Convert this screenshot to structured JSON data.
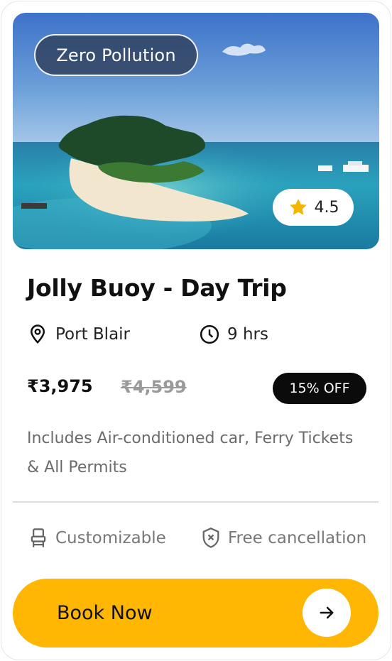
{
  "card": {
    "badge": "Zero Pollution",
    "rating": "4.5",
    "title": "Jolly Buoy - Day Trip",
    "location": "Port Blair",
    "duration": "9 hrs",
    "price": "₹3,975",
    "original_price": "₹4,599",
    "discount": "15% OFF",
    "description": "Includes Air-conditioned car, Ferry Tickets & All Permits",
    "features": {
      "customizable": "Customizable",
      "cancellation": "Free cancellation"
    },
    "cta": "Book Now"
  },
  "icons": {
    "rating": "star-icon",
    "location": "map-pin-icon",
    "duration": "clock-icon",
    "customizable": "sofa-seat-icon",
    "cancellation": "shield-x-icon",
    "cta": "arrow-right-icon"
  },
  "colors": {
    "accent": "#ffb703",
    "badge_bg": "#324362",
    "discount_bg": "#0b0b0b",
    "star": "#f5b400"
  }
}
